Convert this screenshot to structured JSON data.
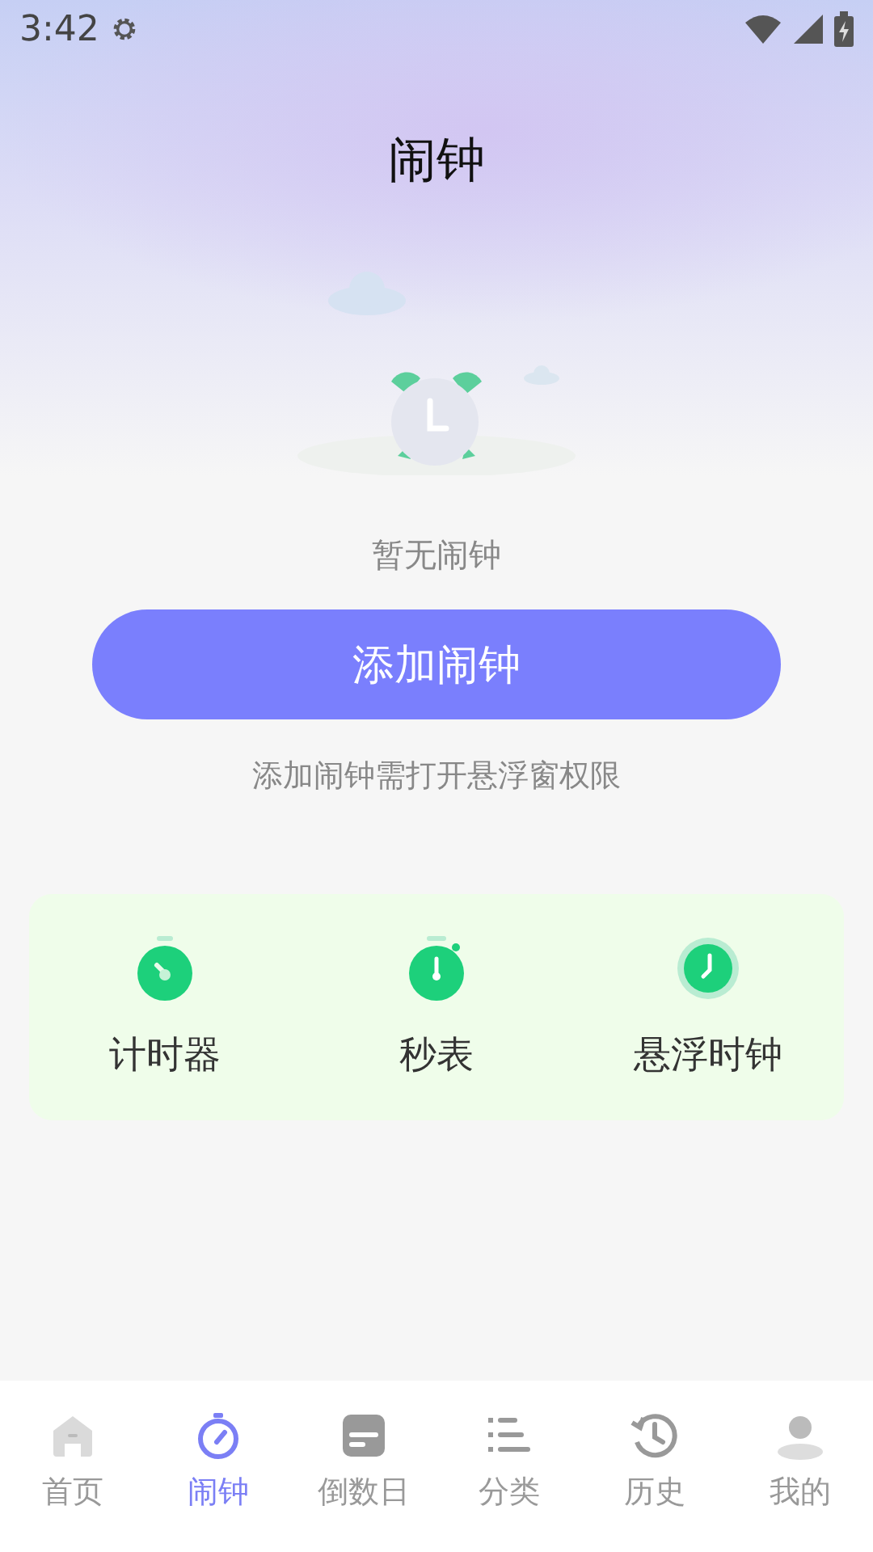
{
  "status_bar": {
    "time": "3:42"
  },
  "title": "闹钟",
  "empty_state": {
    "message": "暂无闹钟",
    "button": "添加闹钟",
    "hint": "添加闹钟需打开悬浮窗权限"
  },
  "tools": [
    {
      "kind": "timer",
      "label": "计时器"
    },
    {
      "kind": "stopwatch",
      "label": "秒表"
    },
    {
      "kind": "floating-clock",
      "label": "悬浮时钟"
    }
  ],
  "nav": [
    {
      "kind": "home",
      "label": "首页",
      "selected": false
    },
    {
      "kind": "alarm",
      "label": "闹钟",
      "selected": true
    },
    {
      "kind": "countdown",
      "label": "倒数日",
      "selected": false
    },
    {
      "kind": "category",
      "label": "分类",
      "selected": false
    },
    {
      "kind": "history",
      "label": "历史",
      "selected": false
    },
    {
      "kind": "profile",
      "label": "我的",
      "selected": false
    }
  ]
}
